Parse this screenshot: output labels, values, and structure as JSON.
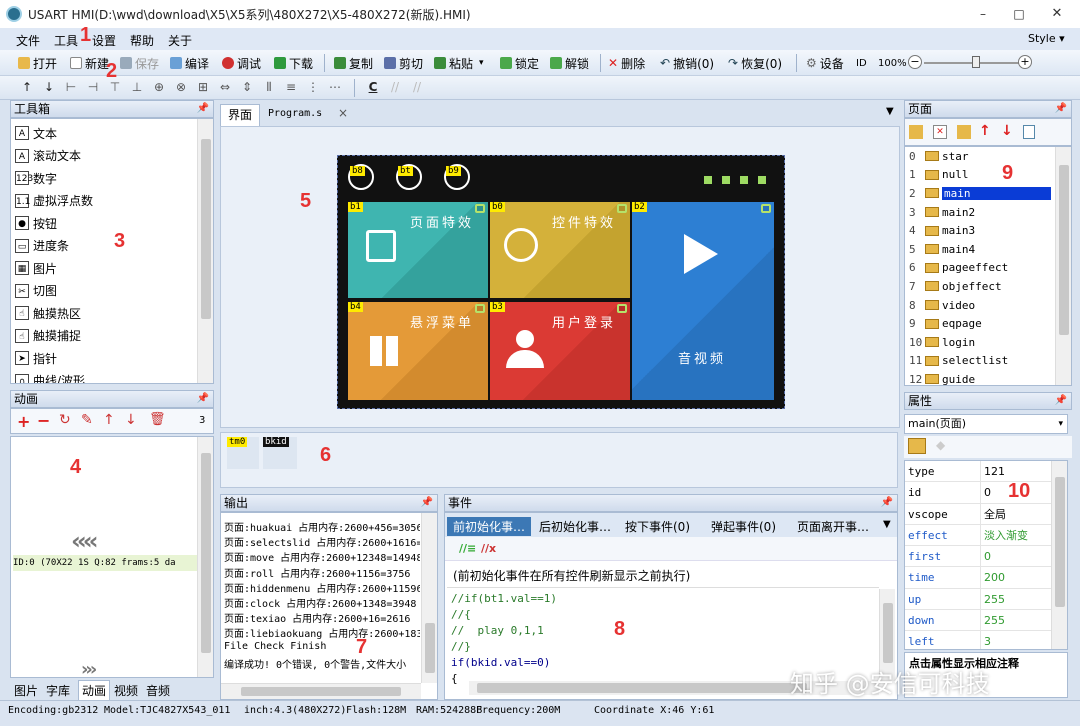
{
  "window": {
    "title": "USART HMI(D:\\wwd\\download\\X5\\X5系列\\480X272\\X5-480X272(新版).HMI)",
    "min": "–",
    "max": "□",
    "close": "✕"
  },
  "menu": {
    "items": [
      "文件",
      "工具",
      "设置",
      "帮助",
      "关于"
    ],
    "style": "Style ▾"
  },
  "toolbar": {
    "open": "打开",
    "new": "新建",
    "save": "保存",
    "compile": "编译",
    "debug": "调试",
    "download": "下载",
    "copy": "复制",
    "cut": "剪切",
    "paste": "粘贴",
    "lock": "锁定",
    "unlock": "解锁",
    "delete": "删除",
    "undo": "撤销(0)",
    "redo": "恢复(0)",
    "device": "设备",
    "id": "ID",
    "zoom": "100%",
    "zoom_level": 0.55
  },
  "toolbox": {
    "title": "工具箱",
    "items": [
      {
        "icon": "A",
        "label": "文本"
      },
      {
        "icon": "A",
        "label": "滚动文本"
      },
      {
        "icon": "123",
        "label": "数字"
      },
      {
        "icon": "1.1",
        "label": "虚拟浮点数"
      },
      {
        "icon": "●",
        "label": "按钮"
      },
      {
        "icon": "▭",
        "label": "进度条"
      },
      {
        "icon": "▦",
        "label": "图片"
      },
      {
        "icon": "✂",
        "label": "切图"
      },
      {
        "icon": "☝",
        "label": "触摸热区"
      },
      {
        "icon": "☝",
        "label": "触摸捕捉"
      },
      {
        "icon": "➤",
        "label": "指针"
      },
      {
        "icon": "∩",
        "label": "曲线/波形"
      }
    ]
  },
  "animation": {
    "title": "动画",
    "count": "3",
    "info": "ID:0  (70X22 1S Q:82  frams:5 da",
    "tabs": [
      "图片",
      "字库",
      "动画",
      "视频",
      "音频"
    ]
  },
  "editor": {
    "tabs": [
      "界面",
      "Program.s"
    ],
    "close": "×"
  },
  "hmi": {
    "tiles": [
      {
        "badge": "b1",
        "label": "页面特效"
      },
      {
        "badge": "b0",
        "label": "控件特效"
      },
      {
        "badge": "b2",
        "label": "音视频"
      },
      {
        "badge": "b4",
        "label": "悬浮菜单"
      },
      {
        "badge": "b3",
        "label": "用户登录"
      }
    ],
    "top_badges": [
      "b8",
      "bt",
      "b9"
    ]
  },
  "timers": {
    "items": [
      "tm0",
      "bkid"
    ]
  },
  "output": {
    "title": "输出",
    "lines": [
      "页面:huakuai 占用内存:2600+456=3056",
      "页面:selectslid 占用内存:2600+1616=",
      "页面:move 占用内存:2600+12348=14948",
      "页面:roll 占用内存:2600+1156=3756",
      "页面:hiddenmenu 占用内存:2600+11596",
      "页面:clock 占用内存:2600+1348=3948",
      "页面:texiao 占用内存:2600+16=2616",
      "页面:liebiaokuang 占用内存:2600+183",
      "File Check Finish",
      "编译成功! 0个错误, 0个警告,文件大小"
    ]
  },
  "events": {
    "title": "事件",
    "tabs": [
      "前初始化事…",
      "后初始化事…",
      "按下事件(0)",
      "弹起事件(0)",
      "页面离开事…"
    ],
    "note": "(前初始化事件在所有控件刷新显示之前执行)",
    "code": [
      "//if(bt1.val==1)",
      "//{",
      "//  play 0,1,1",
      "//}",
      "if(bkid.val==0)",
      "{"
    ]
  },
  "pages": {
    "title": "页面",
    "items": [
      {
        "i": "0",
        "n": "star"
      },
      {
        "i": "1",
        "n": "null"
      },
      {
        "i": "2",
        "n": "main"
      },
      {
        "i": "3",
        "n": "main2"
      },
      {
        "i": "4",
        "n": "main3"
      },
      {
        "i": "5",
        "n": "main4"
      },
      {
        "i": "6",
        "n": "pageeffect"
      },
      {
        "i": "7",
        "n": "objeffect"
      },
      {
        "i": "8",
        "n": "video"
      },
      {
        "i": "9",
        "n": "eqpage"
      },
      {
        "i": "10",
        "n": "login"
      },
      {
        "i": "11",
        "n": "selectlist"
      },
      {
        "i": "12",
        "n": "guide"
      }
    ],
    "selected": "2"
  },
  "props": {
    "title": "属性",
    "selector": "main(页面)",
    "rows": [
      {
        "k": "type",
        "v": "121"
      },
      {
        "k": "id",
        "v": "0"
      },
      {
        "k": "vscope",
        "v": "全局"
      },
      {
        "k": "effect",
        "v": "淡入渐变"
      },
      {
        "k": "first",
        "v": "0"
      },
      {
        "k": "time",
        "v": "200"
      },
      {
        "k": "up",
        "v": "255"
      },
      {
        "k": "down",
        "v": "255"
      },
      {
        "k": "left",
        "v": "3"
      }
    ],
    "hint": "点击属性显示相应注释"
  },
  "status": {
    "encoding": "Encoding:gb2312",
    "model": "Model:TJC4827X543_011",
    "inch": "inch:4.3(480X272)",
    "flash": "Flash:128M",
    "ram": "RAM:524288B",
    "freq": "Frequency:200M",
    "coord": "Coordinate X:46  Y:61"
  },
  "watermark": "知乎 @安信可科技",
  "markers": [
    "1",
    "2",
    "3",
    "4",
    "5",
    "6",
    "7",
    "8",
    "9",
    "10"
  ],
  "colors": {
    "teal": "#3fb5b0",
    "yellow": "#d4b13a",
    "blue": "#2d7fd3",
    "orange": "#e49a38",
    "red": "#db3a34",
    "marker": "#e63232"
  }
}
